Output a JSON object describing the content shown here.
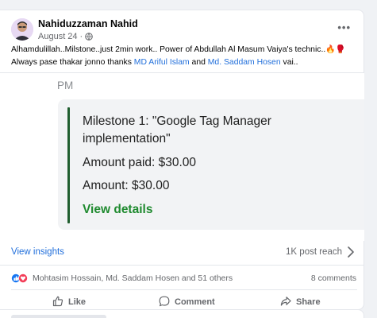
{
  "post": {
    "author": "Nahiduzzaman Nahid",
    "date": "August 24",
    "date_separator": "·",
    "more_label": "•••",
    "text_part1": "Alhamdulillah..Milstone..just 2min work.. Power of  Abdullah Al Masum  Vaiya's technic..",
    "text_emojis": "🔥🥊",
    "text_part2": "Always pase thakar jonno thanks ",
    "mention1": "MD Ariful Islam",
    "text_and": " and ",
    "mention2": "Md. Saddam Hosen",
    "text_part3": " vai.."
  },
  "shared": {
    "pm_label": "PM",
    "milestone_title": "Milestone 1: \"Google Tag Manager implementation\"",
    "amount_paid": "Amount paid: $30.00",
    "amount": "Amount: $30.00",
    "view_details": "View details"
  },
  "insights": {
    "view_insights": "View insights",
    "post_reach": "1K post reach"
  },
  "reactions": {
    "names": "Mohtasim Hossain, Md. Saddam Hosen and 51 others",
    "comments": "8 comments"
  },
  "actions": {
    "like": "Like",
    "comment": "Comment",
    "share": "Share"
  },
  "colors": {
    "link": "#216fdb",
    "milestone_green": "#1f8a2f",
    "milestone_bar": "#1f5d2e",
    "page_bg": "#f0f2f5"
  },
  "icons": {
    "globe": "globe-icon",
    "more": "more-options-icon",
    "chevron": "chevron-right-icon",
    "like_reaction": "like-reaction-icon",
    "love_reaction": "love-reaction-icon",
    "like_action": "thumbs-up-icon",
    "comment_action": "comment-bubble-icon",
    "share_action": "share-arrow-icon"
  }
}
